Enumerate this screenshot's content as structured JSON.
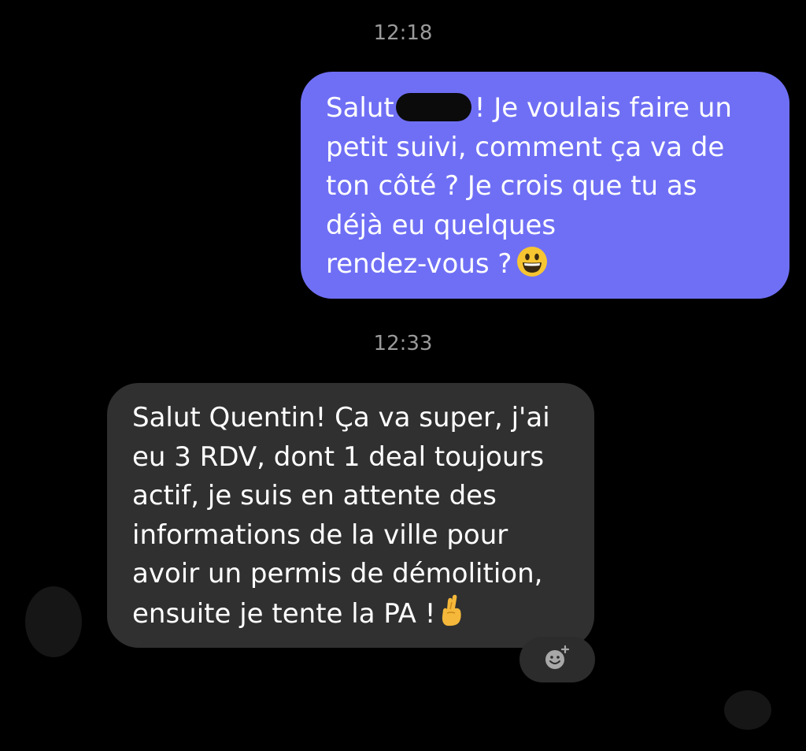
{
  "conversation": {
    "messages": [
      {
        "timestamp": "12:18",
        "direction": "sent",
        "lines": [
          "Salut",
          "! Je voulais faire un",
          "petit suivi, comment ça va de",
          "ton côté ? Je crois que tu as",
          "déjà eu quelques",
          "rendez-vous ?"
        ],
        "emoji": "grinning-face"
      },
      {
        "timestamp": "12:33",
        "direction": "received",
        "lines": [
          "Salut Quentin! Ça va super, j'ai",
          "eu 3 RDV, dont 1 deal toujours",
          "actif, je suis en attente des",
          "informations de la ville pour",
          "avoir un permis de démolition,",
          "ensuite je tente la PA !"
        ],
        "emoji": "crossed-fingers"
      }
    ]
  },
  "colors": {
    "background": "#000000",
    "sent_bubble": "#6f6ff5",
    "received_bubble": "#303030",
    "timestamp": "#9a9a9a",
    "text": "#ffffff"
  },
  "icons": {
    "reaction": "add-reaction-icon"
  }
}
